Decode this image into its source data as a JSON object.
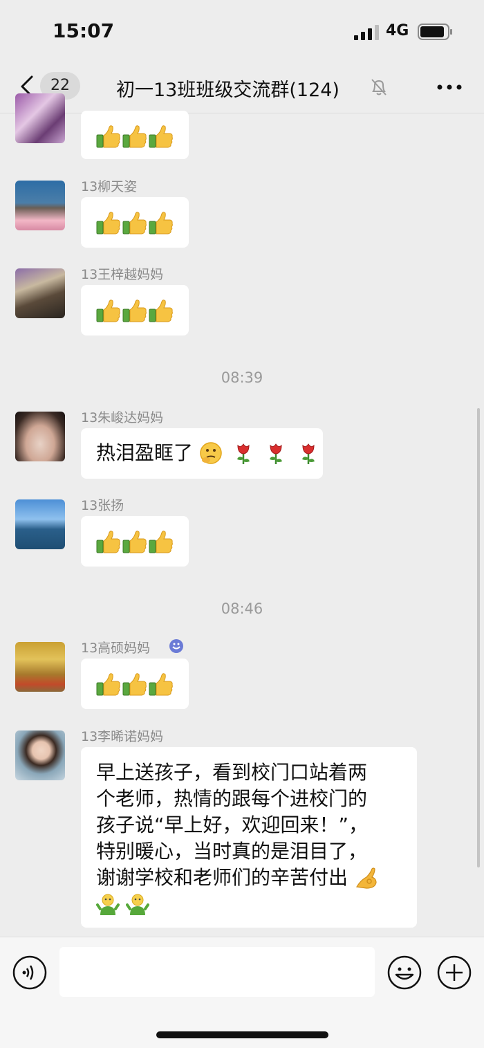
{
  "status": {
    "time": "15:07",
    "network": "4G"
  },
  "nav": {
    "unread": "22",
    "title": "初一13班班级交流群(124)"
  },
  "messages": [
    {
      "sender": "13柳天姿"
    },
    {
      "sender": "13王梓越妈妈"
    },
    {
      "sender": "13朱峻达妈妈",
      "text": "热泪盈眶了"
    },
    {
      "sender": "13张扬"
    },
    {
      "sender": "13高硕妈妈"
    },
    {
      "sender": "13李晞诺妈妈",
      "lines": [
        "早上送孩子，看到校门口站着两",
        "个老师，热情的跟每个进校门的",
        "孩子说“早上好，欢迎回来！”，",
        "特别暖心，当时真的是泪目了，",
        "谢谢学校和老师们的辛苦付出"
      ]
    }
  ],
  "timestamps": [
    "08:39",
    "08:46"
  ],
  "icons": {
    "back": "chevron-left-icon",
    "mute": "bell-slash-icon",
    "more": "ellipsis-icon",
    "thumbs": "thumbs-up-icon",
    "rose": "rose-icon",
    "voice": "voice-icon",
    "emoji": "smiley-icon",
    "plus": "plus-icon"
  },
  "colors": {
    "background": "#ededed",
    "bubble": "#ffffff",
    "meta_text": "#8a8a8a"
  }
}
